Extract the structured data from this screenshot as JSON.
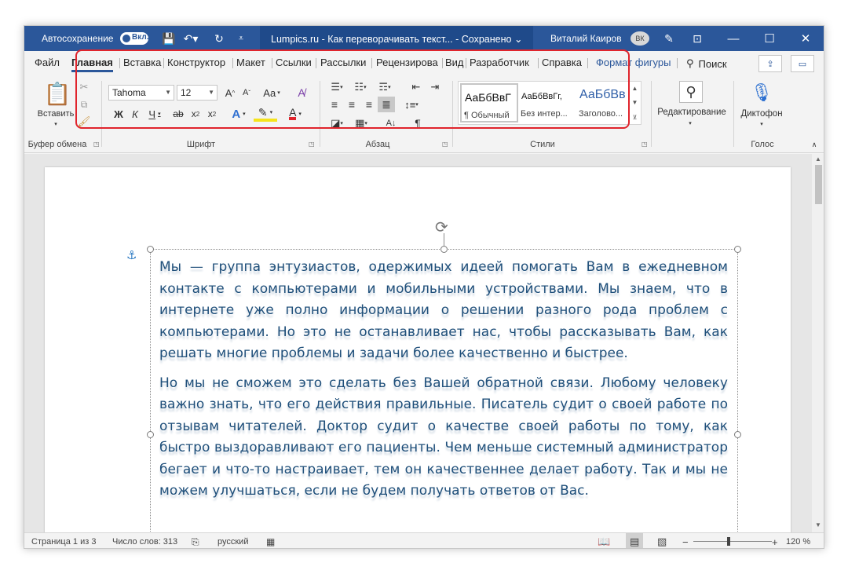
{
  "titlebar": {
    "autosave_label": "Автосохранение",
    "autosave_state": "Вкл.",
    "document_title": "Lumpics.ru - Как переворачивать текст... - Сохранено ⌄",
    "user_name": "Виталий Каиров",
    "user_initials": "ВК"
  },
  "tabs": {
    "file": "Файл",
    "home": "Главная",
    "insert": "Вставка",
    "design": "Конструктор",
    "layout": "Макет",
    "references": "Ссылки",
    "mailings": "Рассылки",
    "review": "Рецензирова",
    "view": "Вид",
    "developer": "Разработчик",
    "help": "Справка",
    "shape_format": "Формат фигуры",
    "search": "Поиск"
  },
  "ribbon": {
    "clipboard": {
      "paste_label": "Вставить",
      "group_label": "Буфер обмена"
    },
    "font": {
      "font_name": "Tahoma",
      "font_size": "12",
      "bold": "Ж",
      "italic": "К",
      "underline": "Ч",
      "strike": "ab",
      "case": "Aa",
      "grow": "A",
      "shrink": "A",
      "effects": "A",
      "font_color": "A",
      "group_label": "Шрифт"
    },
    "paragraph": {
      "group_label": "Абзац"
    },
    "styles": {
      "items": [
        {
          "sample": "АаБбВвГ",
          "name": "¶ Обычный"
        },
        {
          "sample": "АаБбВвГг,",
          "name": "Без интер..."
        },
        {
          "sample": "АаБбВв",
          "name": "Заголово..."
        }
      ],
      "group_label": "Стили"
    },
    "editing": {
      "label": "Редактирование"
    },
    "voice": {
      "dictate_label": "Диктофон",
      "group_label": "Голос"
    }
  },
  "document": {
    "paragraphs": [
      "Мы — группа энтузиастов, одержимых идеей помогать Вам в ежедневном контакте с компьютерами и мобильными устройствами. Мы знаем, что в интернете уже полно информации о решении разного рода проблем с компьютерами. Но это не останавливает нас, чтобы рассказывать Вам, как решать многие проблемы и задачи более качественно и быстрее.",
      "Но мы не сможем это сделать без Вашей обратной связи. Любому человеку важно знать, что его действия правильные. Писатель судит о своей работе по отзывам читателей. Доктор судит о качестве своей работы по тому, как быстро выздоравливают его пациенты. Чем меньше системный администратор бегает и что-то настраивает, тем он качественнее делает работу. Так и мы не можем улучшаться, если не будем получать ответов от Вас."
    ]
  },
  "statusbar": {
    "page": "Страница 1 из 3",
    "words": "Число слов: 313",
    "language": "русский",
    "zoom": "120 %",
    "zoom_fraction": 0.45
  },
  "colors": {
    "brand": "#2b579a",
    "highlight_border": "#e0242c",
    "text_color": "#1f4f7a"
  }
}
